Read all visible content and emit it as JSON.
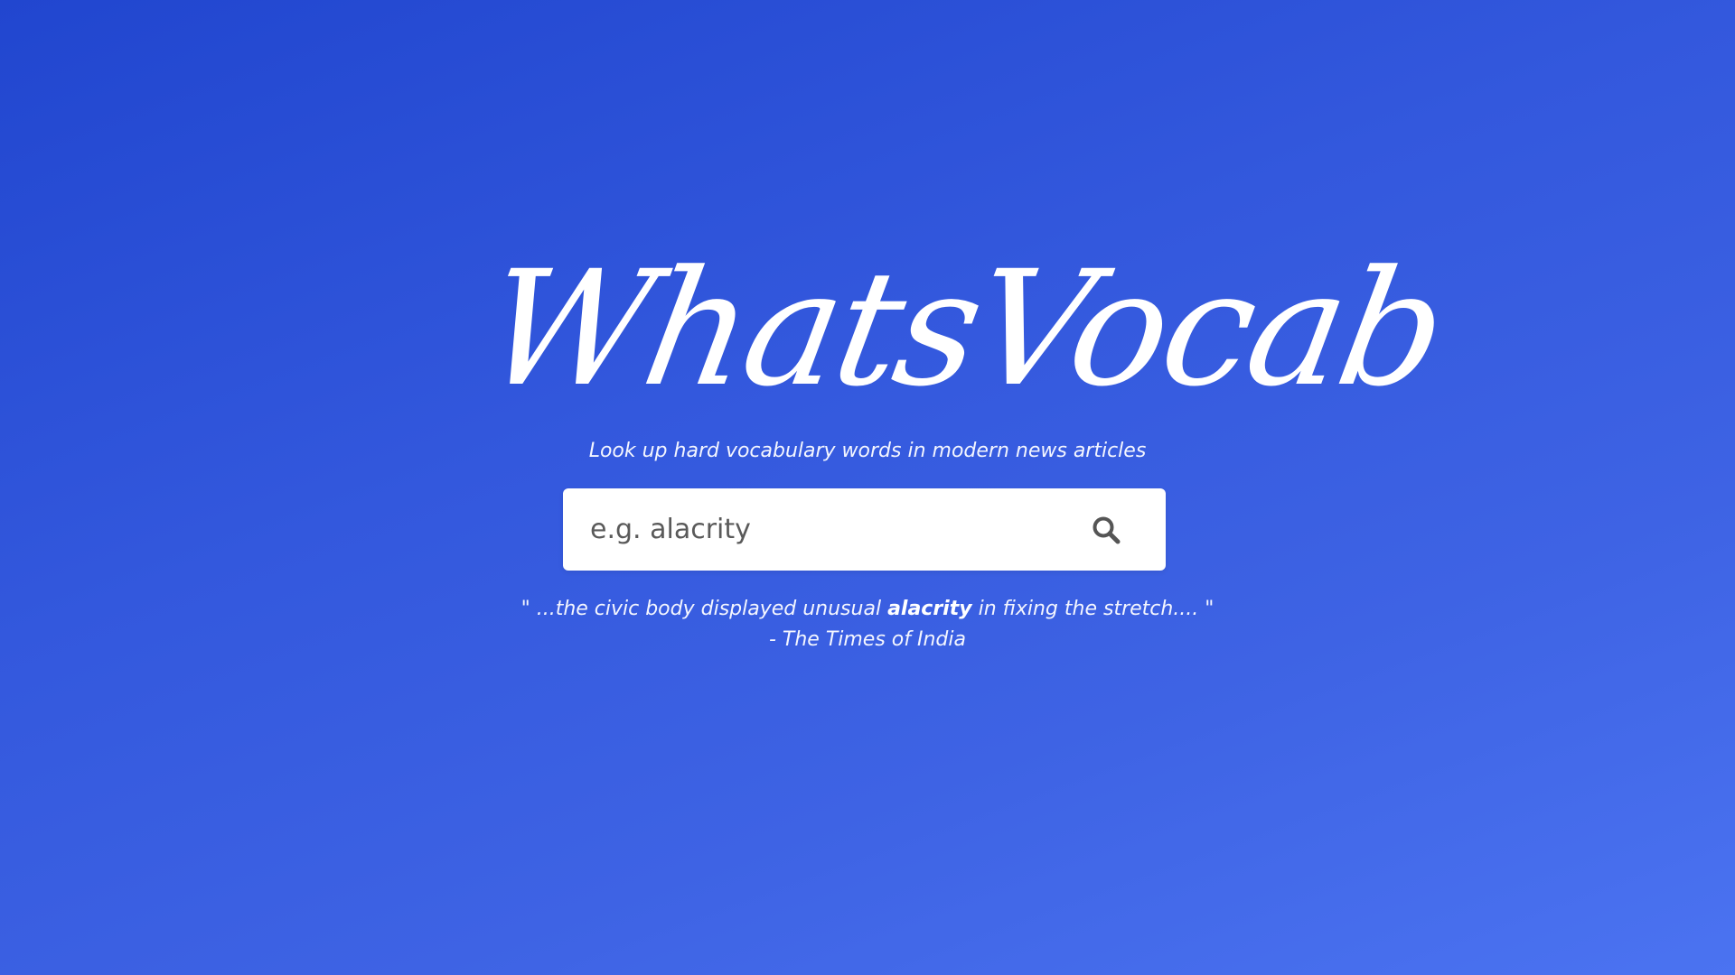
{
  "brand": {
    "logo_text": "WhatsVocab"
  },
  "tagline": "Look up hard vocabulary words in modern news articles",
  "search": {
    "placeholder": "e.g. alacrity",
    "icon": "search-icon"
  },
  "example_quote": {
    "open_mark": "\"",
    "before": " ...the civic body displayed unusual ",
    "highlight": "alacrity",
    "after": " in fixing the stretch.... ",
    "close_mark": "\"",
    "source": "- The Times of India"
  },
  "colors": {
    "background_start": "#2146cf",
    "background_end": "#4b73f1",
    "search_box": "#ffffff",
    "icon": "#555555"
  }
}
